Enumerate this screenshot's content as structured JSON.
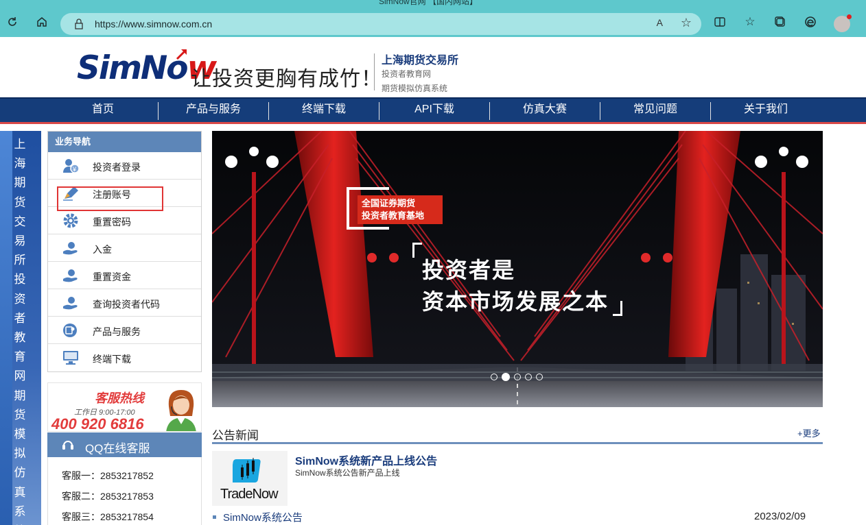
{
  "browser": {
    "tab_title": "SimNow官网 【国内网站】",
    "url": "https://www.simnow.com.cn",
    "read_aloud_label": "A",
    "icons": [
      "refresh-icon",
      "home-icon",
      "lock-icon",
      "read-aloud-icon",
      "add-favorite-icon",
      "split-screen-icon",
      "favorites-icon",
      "collections-icon",
      "edge-icon",
      "profile-icon"
    ]
  },
  "header": {
    "logo_sim": "SimNo",
    "logo_w": "w",
    "slogan": "让投资更胸有成竹！",
    "org_name": "上海期货交易所",
    "org_sub1": "投资者教育网",
    "org_sub2": "期货模拟仿真系统"
  },
  "nav": {
    "items": [
      "首页",
      "产品与服务",
      "终端下载",
      "API下载",
      "仿真大赛",
      "常见问题",
      "关于我们"
    ]
  },
  "left_banner": {
    "text": "上海期货交易所投资者教育网期货模拟仿真系统"
  },
  "business_nav": {
    "title": "业务导航",
    "items": [
      {
        "label": "投资者登录",
        "icon": "user-login-icon"
      },
      {
        "label": "注册账号",
        "icon": "register-pen-icon"
      },
      {
        "label": "重置密码",
        "icon": "gear-icon"
      },
      {
        "label": "入金",
        "icon": "hand-coin-icon"
      },
      {
        "label": "重置资金",
        "icon": "hand-coin-icon"
      },
      {
        "label": "查询投资者代码",
        "icon": "hand-coin-icon"
      },
      {
        "label": "产品与服务",
        "icon": "product-service-icon"
      },
      {
        "label": "终端下载",
        "icon": "monitor-icon"
      }
    ]
  },
  "hotline": {
    "title": "客服热线",
    "hours": "工作日 9:00-17:00",
    "number": "400 920 6816"
  },
  "qq": {
    "title": "QQ在线客服",
    "rows": [
      "客服一：2853217852",
      "客服二：2853217853",
      "客服三：2853217854"
    ]
  },
  "hero": {
    "tag_line1": "全国证券期货",
    "tag_line2": "投资者教育基地",
    "headline1": "投资者是",
    "headline2": "资本市场发展之本",
    "slide_count": 5,
    "active_slide": 2
  },
  "news": {
    "title": "公告新闻",
    "more": "+更多",
    "logo_text": "TradeNow",
    "headline": "SimNow系统新产品上线公告",
    "subline": "SimNow系统公告新产品上线",
    "item": "SimNow系统公告",
    "date": "2023/02/09"
  },
  "colors": {
    "browser_bg": "#5ec8cc",
    "nav_bg": "#153d7a",
    "panel_head": "#5d86b8",
    "accent_red": "#e23c3c",
    "highlight_box": "#e03434"
  }
}
